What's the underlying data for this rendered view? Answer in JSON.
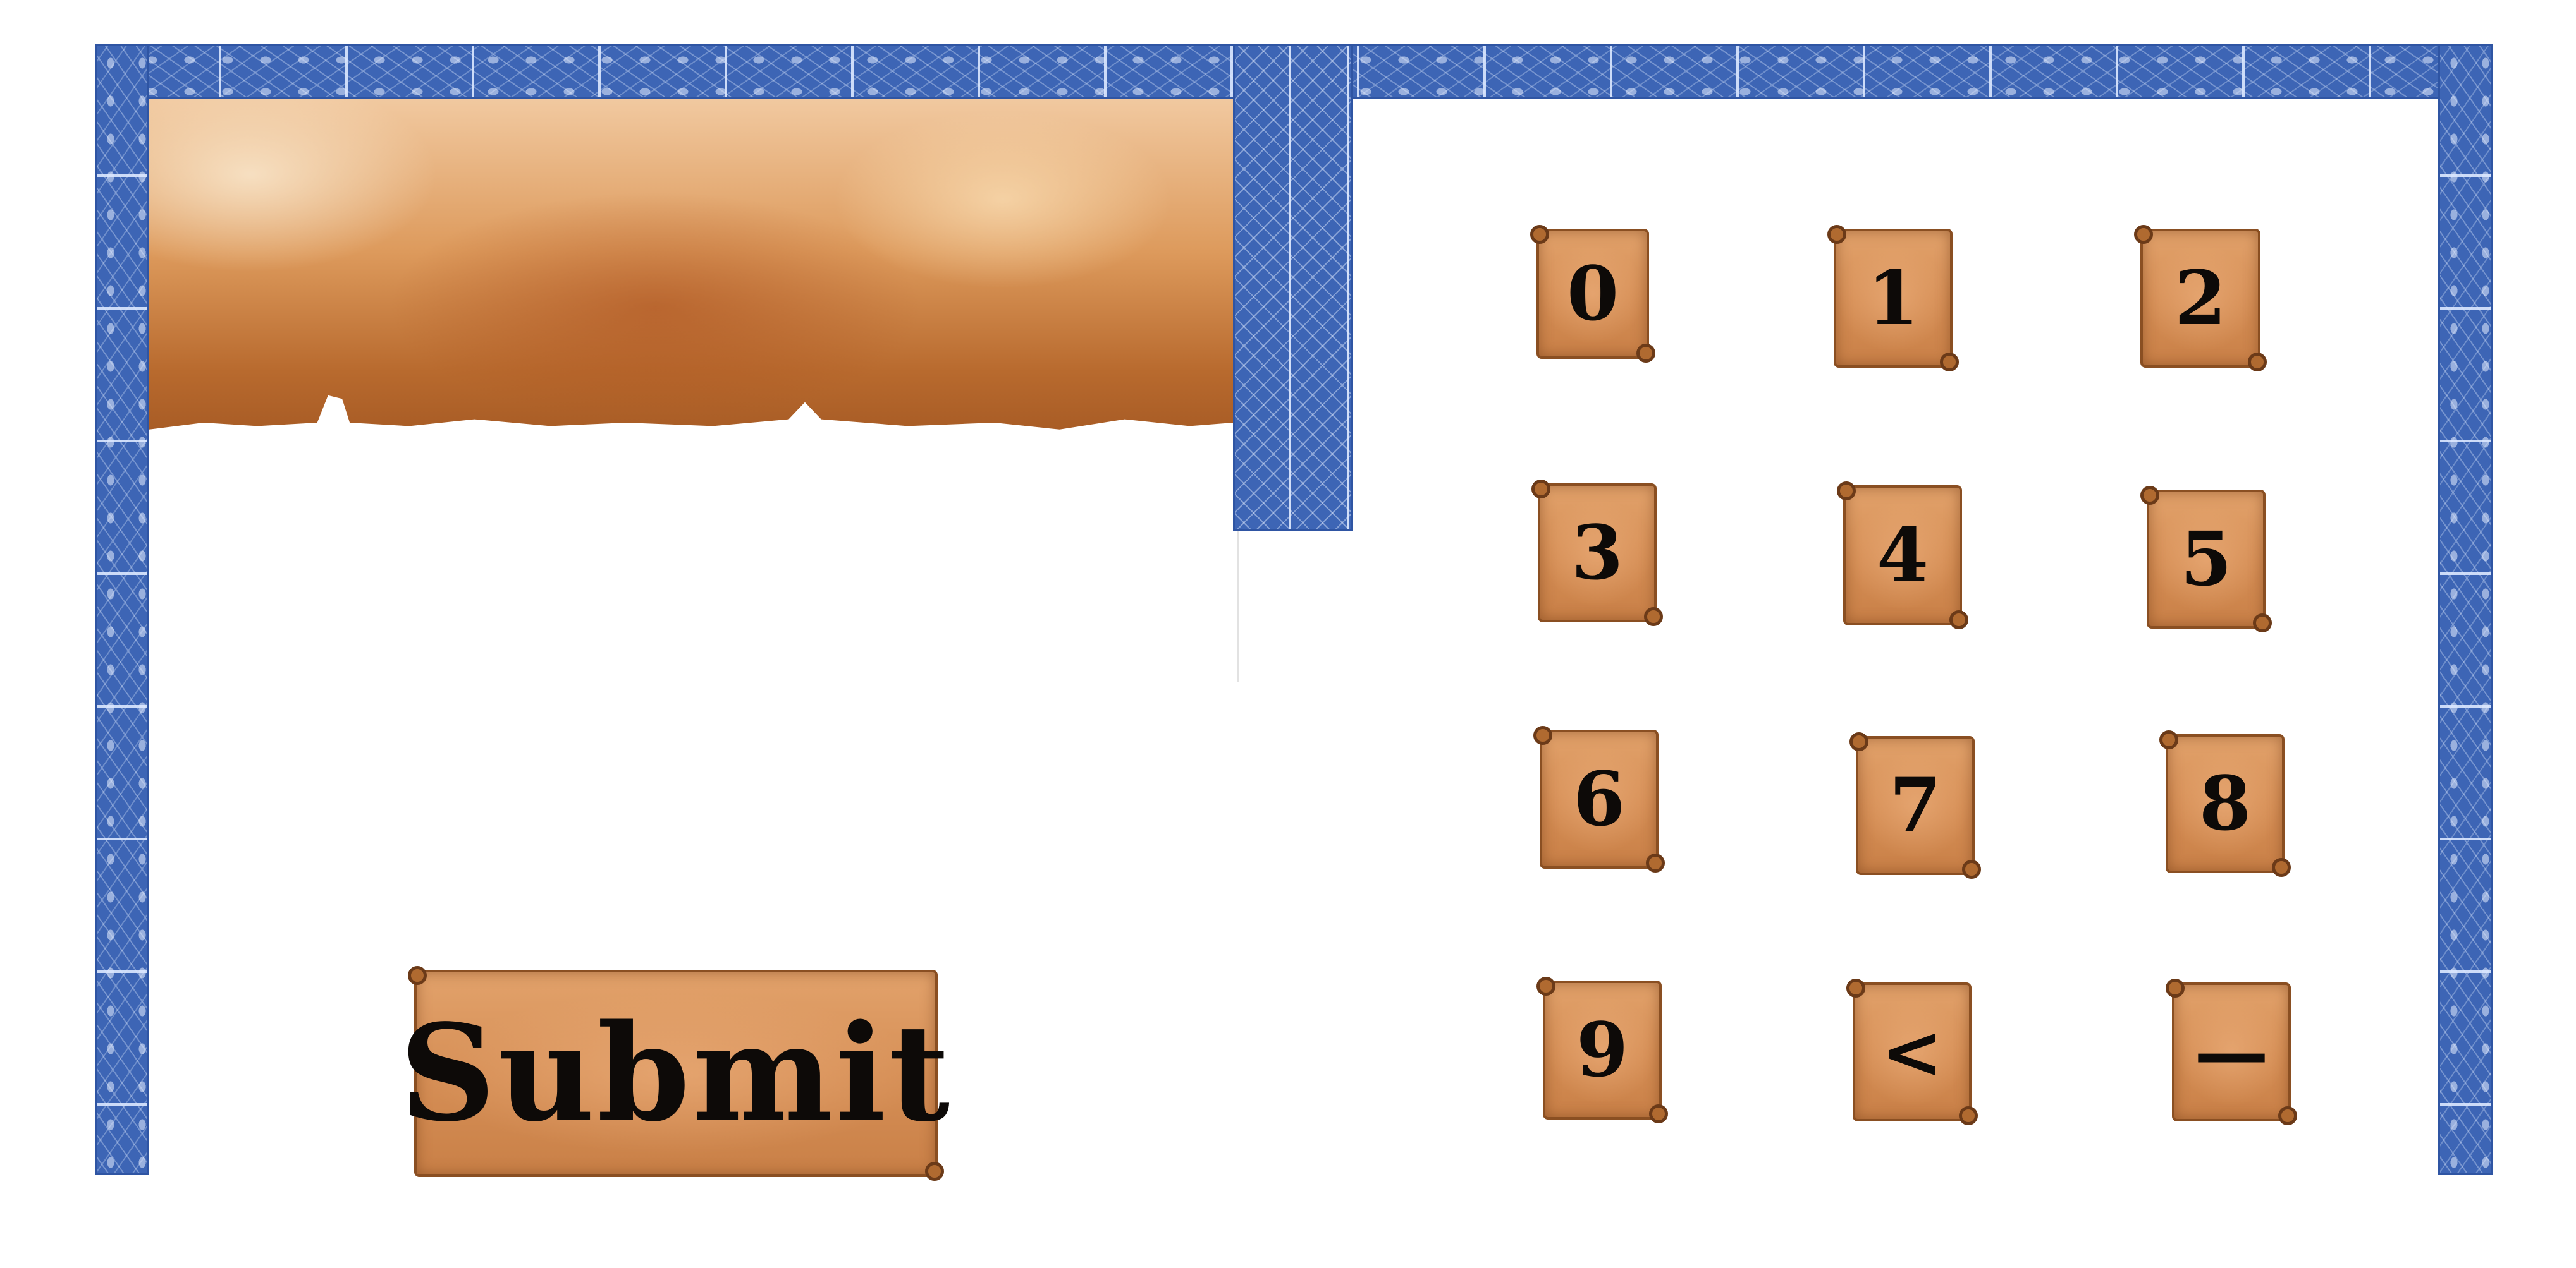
{
  "keypad": {
    "keys": [
      {
        "label": "0"
      },
      {
        "label": "1"
      },
      {
        "label": "2"
      },
      {
        "label": "3"
      },
      {
        "label": "4"
      },
      {
        "label": "5"
      },
      {
        "label": "6"
      },
      {
        "label": "7"
      },
      {
        "label": "8"
      },
      {
        "label": "9"
      },
      {
        "label": "<"
      },
      {
        "label": "—"
      }
    ]
  },
  "submit": {
    "label": "Submit"
  },
  "colors": {
    "border_blue": "#3d65b5",
    "parchment": "#d68f56",
    "ink": "#0d0a08"
  },
  "icons": {
    "key_background": "parchment-scroll-icon",
    "banner": "parchment-banner"
  }
}
